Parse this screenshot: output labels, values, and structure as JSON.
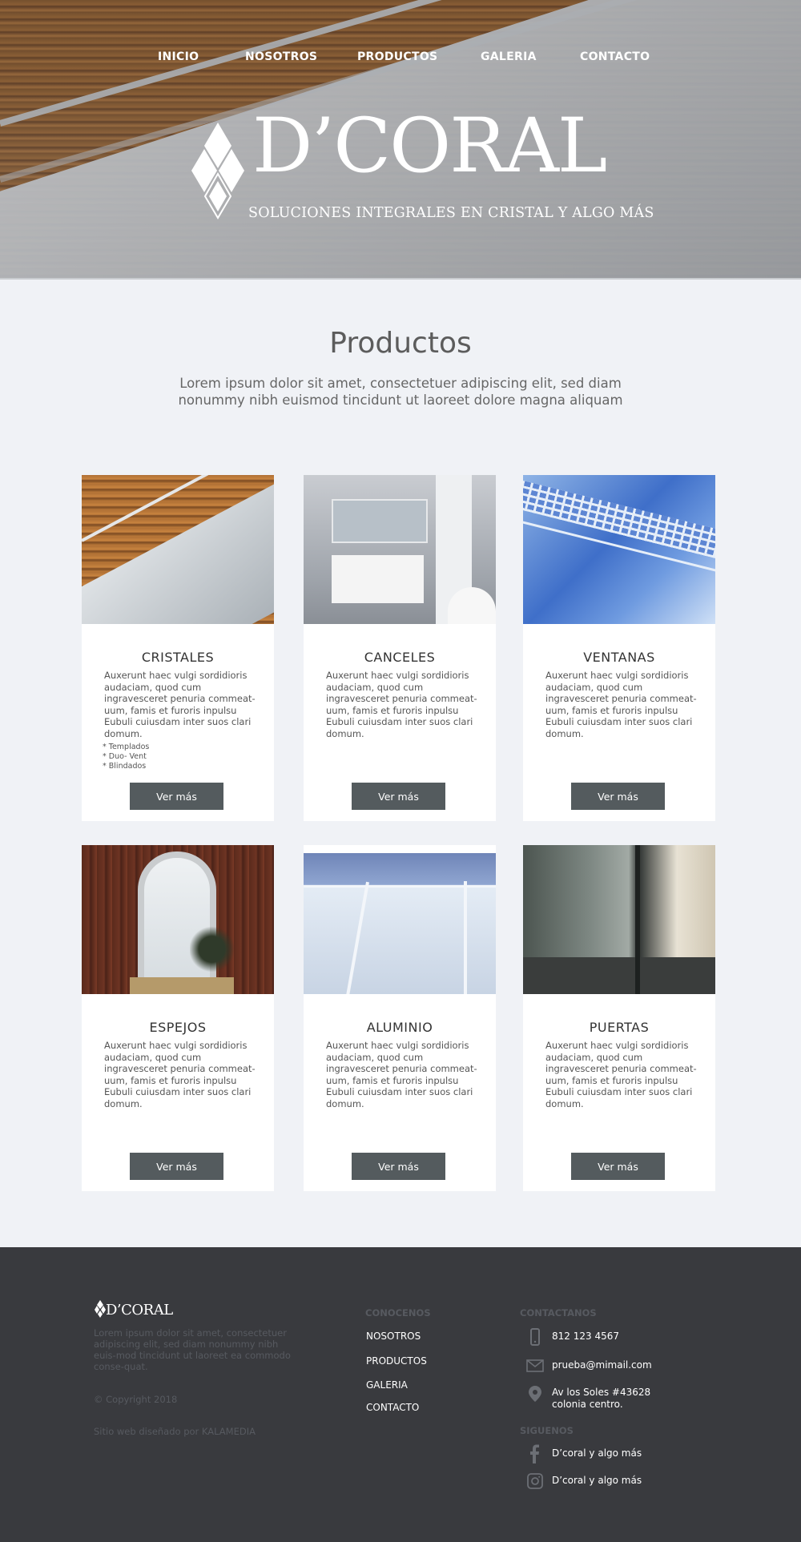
{
  "nav": {
    "items": [
      {
        "label": "INICIO"
      },
      {
        "label": "NOSOTROS"
      },
      {
        "label": "PRODUCTOS"
      },
      {
        "label": "GALERIA"
      },
      {
        "label": "CONTACTO"
      }
    ]
  },
  "brand": {
    "name": "D’CORAL",
    "tagline": "SOLUCIONES INTEGRALES EN CRISTAL Y ALGO MÁS"
  },
  "intro": {
    "title": "Productos",
    "text": "Lorem ipsum dolor sit amet, consectetuer adipiscing elit, sed diam nonummy nibh euismod tincidunt ut laoreet dolore magna aliquam"
  },
  "products": [
    {
      "title": "CRISTALES",
      "text": "Auxerunt haec vulgi sordidioris audaciam, quod cum ingravesceret penuria commeat-uum, famis et furoris inpulsu Eubuli cuiusdam inter suos clari domum.",
      "list": [
        "* Templados",
        "* Duo- Vent",
        "* Blindados"
      ],
      "button": "Ver más"
    },
    {
      "title": "CANCELES",
      "text": "Auxerunt haec vulgi sordidioris audaciam, quod cum ingravesceret penuria commeat-uum, famis et furoris inpulsu Eubuli cuiusdam inter suos clari domum.",
      "button": "Ver más"
    },
    {
      "title": "VENTANAS",
      "text": "Auxerunt haec vulgi sordidioris audaciam, quod cum ingravesceret penuria commeat-uum, famis et furoris inpulsu Eubuli cuiusdam inter suos clari domum.",
      "button": "Ver más"
    },
    {
      "title": "ESPEJOS",
      "text": "Auxerunt haec vulgi sordidioris audaciam, quod cum ingravesceret penuria commeat-uum, famis et furoris inpulsu Eubuli cuiusdam inter suos clari domum.",
      "button": "Ver más"
    },
    {
      "title": "ALUMINIO",
      "text": "Auxerunt haec vulgi sordidioris audaciam, quod cum ingravesceret penuria commeat-uum, famis et furoris inpulsu Eubuli cuiusdam inter suos clari domum.",
      "button": "Ver más"
    },
    {
      "title": "PUERTAS",
      "text": "Auxerunt haec vulgi sordidioris audaciam, quod cum ingravesceret penuria commeat-uum, famis et furoris inpulsu Eubuli cuiusdam inter suos clari domum.",
      "button": "Ver más"
    }
  ],
  "footer": {
    "logo": "D’CORAL",
    "about": "Lorem ipsum dolor sit amet, consectetuer adipiscing elit, sed diam nonummy nibh euis-mod tincidunt ut laoreet ea commodo conse-quat.",
    "copyright": "© Copyright 2018",
    "credit": "Sitio web diseñado por KALAMEDIA",
    "conocenos_heading": "CONOCENOS",
    "links": [
      "NOSOTROS",
      "PRODUCTOS",
      "GALERIA",
      "CONTACTO"
    ],
    "contact_heading": "CONTACTANOS",
    "phone": "812 123 4567",
    "email": "prueba@mimail.com",
    "address_line1": "Av los Soles #43628",
    "address_line2": "colonia centro.",
    "follow_heading": "SIGUENOS",
    "facebook": "D’coral  y algo más",
    "instagram": "D’coral y algo más"
  },
  "colors": {
    "background": "#f0f2f6",
    "button": "#545b5e",
    "footer": "#393a3e",
    "footer_muted": "#575a60"
  }
}
